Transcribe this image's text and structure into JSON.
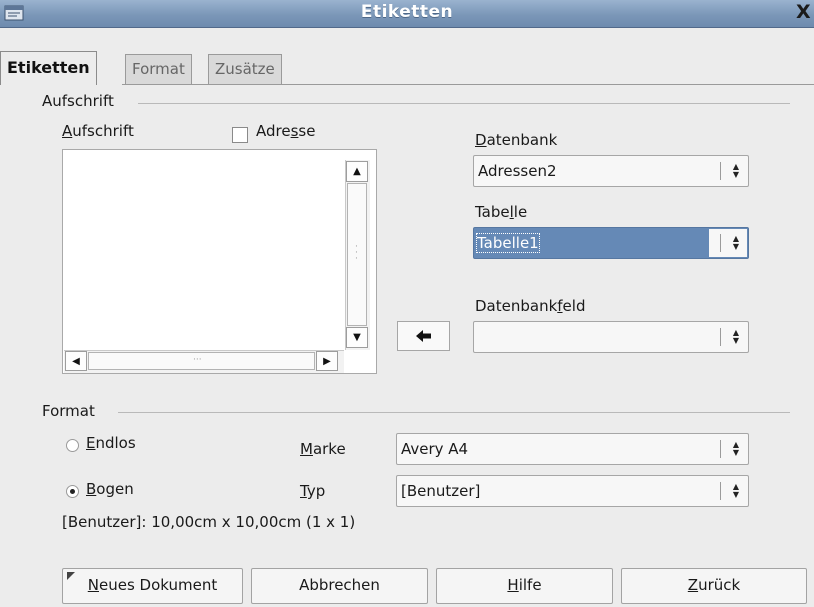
{
  "window": {
    "title": "Etiketten",
    "close_glyph": "X",
    "app_icon": "window-menu-icon"
  },
  "tabs": [
    {
      "label": "Etiketten",
      "active": true
    },
    {
      "label": "Format",
      "active": false
    },
    {
      "label": "Zusätze",
      "active": false
    }
  ],
  "aufschrift_group": {
    "title": "Aufschrift",
    "field_label_mnemonic": "A",
    "field_label_rest": "ufschrift",
    "checkbox_pre": "Adre",
    "checkbox_mnemonic": "s",
    "checkbox_post": "se",
    "checkbox_checked": false,
    "arrow_button_icon": "arrow-left-icon",
    "datenbank": {
      "label_mnemonic": "D",
      "label_rest": "atenbank",
      "value": "Adressen2"
    },
    "tabelle": {
      "label_pre": "Tabe",
      "label_mnemonic": "l",
      "label_post": "le",
      "value": "Tabelle1"
    },
    "datenbankfeld": {
      "label_pre": "Datenbank",
      "label_mnemonic": "f",
      "label_post": "eld",
      "value": ""
    }
  },
  "format_group": {
    "title": "Format",
    "endlos": {
      "mnemonic": "E",
      "rest": "ndlos",
      "selected": false
    },
    "bogen": {
      "mnemonic": "B",
      "rest": "ogen",
      "selected": true
    },
    "marke": {
      "label_mnemonic": "M",
      "label_rest": "arke",
      "value": "Avery A4"
    },
    "typ": {
      "label_mnemonic": "T",
      "label_rest": "yp",
      "value": "[Benutzer]"
    },
    "info": "[Benutzer]: 10,00cm x 10,00cm (1 x 1)"
  },
  "buttons": {
    "neues_mnemonic": "N",
    "neues_rest": "eues Dokument",
    "abbrechen": "Abbrechen",
    "hilfe_mnemonic": "H",
    "hilfe_rest": "ilfe",
    "zurueck_mnemonic": "Z",
    "zurueck_rest": "urück"
  }
}
